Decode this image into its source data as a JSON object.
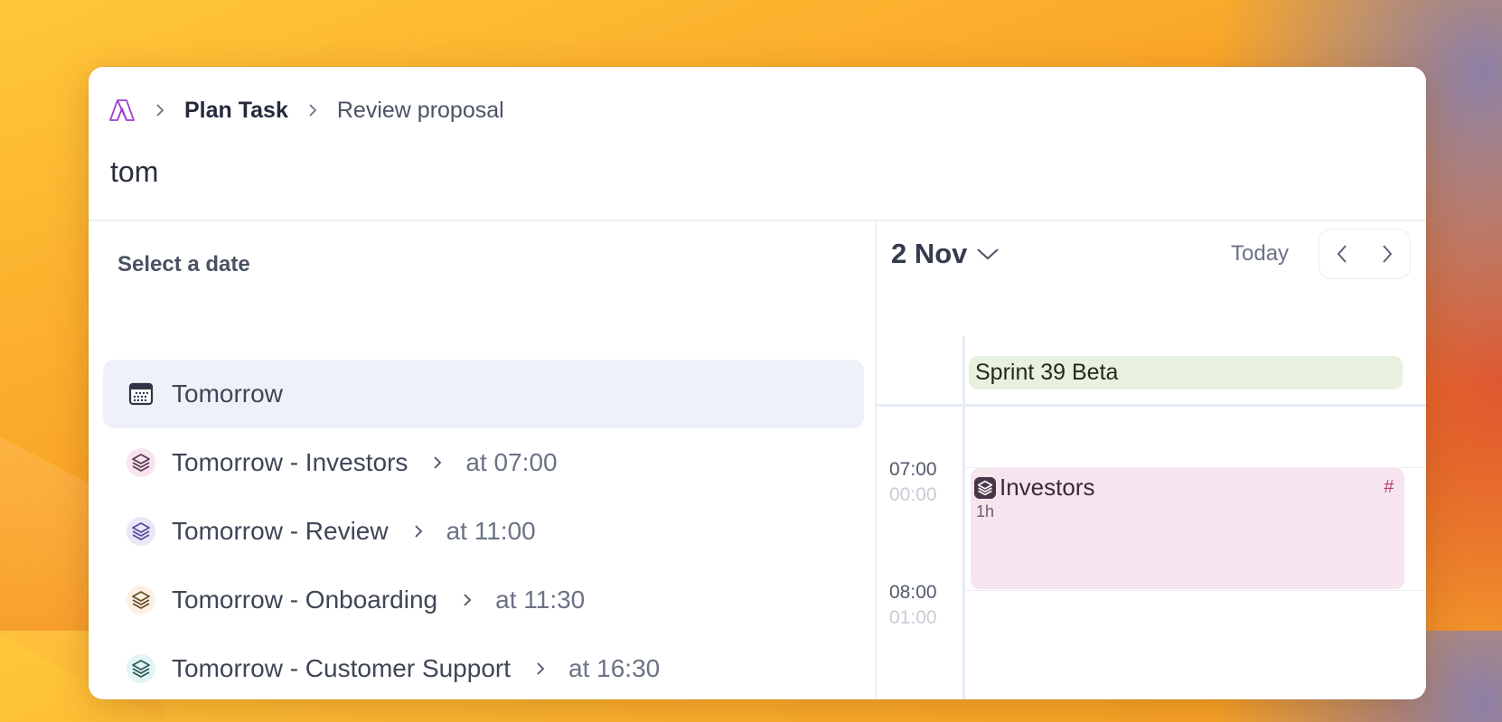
{
  "breadcrumb": {
    "logo_icon": "app-logo",
    "items": [
      "Plan Task",
      "Review proposal"
    ]
  },
  "title": "tom",
  "left_panel": {
    "section_label": "Select a date",
    "rows": [
      {
        "label": "Tomorrow",
        "time": null,
        "icon": "calendar-icon",
        "selected": true
      },
      {
        "label": "Tomorrow - Investors",
        "time": "at 07:00",
        "icon": "stack-icon",
        "icon_color": "#5a3a55",
        "icon_bg": "#f7e4ee"
      },
      {
        "label": "Tomorrow - Review",
        "time": "at 11:00",
        "icon": "stack-icon",
        "icon_color": "#5a4a9a",
        "icon_bg": "#ebe6f7"
      },
      {
        "label": "Tomorrow - Onboarding",
        "time": "at 11:30",
        "icon": "stack-icon",
        "icon_color": "#6a5030",
        "icon_bg": "#fbf0e2"
      },
      {
        "label": "Tomorrow - Customer Support",
        "time": "at 16:30",
        "icon": "stack-icon",
        "icon_color": "#2f5a5a",
        "icon_bg": "#e2f4f4"
      }
    ]
  },
  "calendar": {
    "date_label": "2 Nov",
    "today_label": "Today",
    "all_day_event": {
      "title": "Sprint 39 Beta",
      "color": "#e8f0e0"
    },
    "hours": [
      {
        "time": "07:00",
        "alt_time": "00:00"
      },
      {
        "time": "08:00",
        "alt_time": "01:00"
      }
    ],
    "event": {
      "title": "Investors",
      "duration": "1h",
      "tag": "#",
      "color": "#f6e4ee"
    }
  },
  "colors": {
    "brand": "#9b3fd0",
    "selected_row_bg": "#eef2f8"
  }
}
